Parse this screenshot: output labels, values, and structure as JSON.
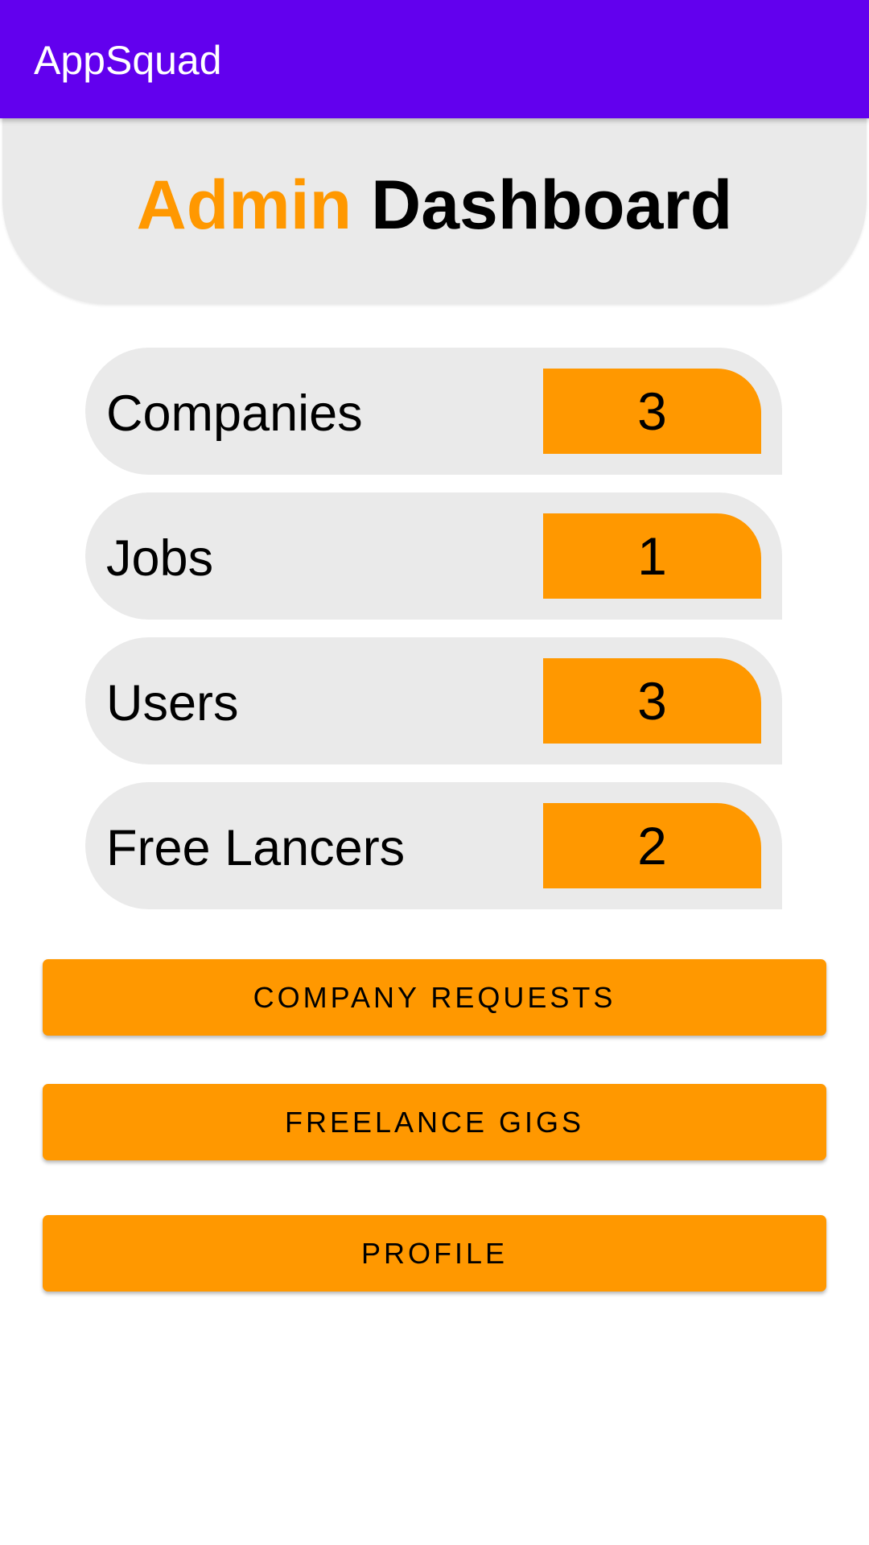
{
  "app_bar": {
    "title": "AppSquad",
    "color": "#6200EE"
  },
  "header": {
    "title_highlight": "Admin",
    "title_rest": "Dashboard",
    "highlight_color": "#FF9800"
  },
  "stats": [
    {
      "label": "Companies",
      "value": "3"
    },
    {
      "label": "Jobs",
      "value": "1"
    },
    {
      "label": "Users",
      "value": "3"
    },
    {
      "label": "Free Lancers",
      "value": "2"
    }
  ],
  "buttons": {
    "company_requests": "COMPANY REQUESTS",
    "freelance_gigs": "FREELANCE GIGS",
    "profile": "PROFILE"
  },
  "colors": {
    "accent": "#FF9800",
    "card_background": "#EAEAEA"
  }
}
